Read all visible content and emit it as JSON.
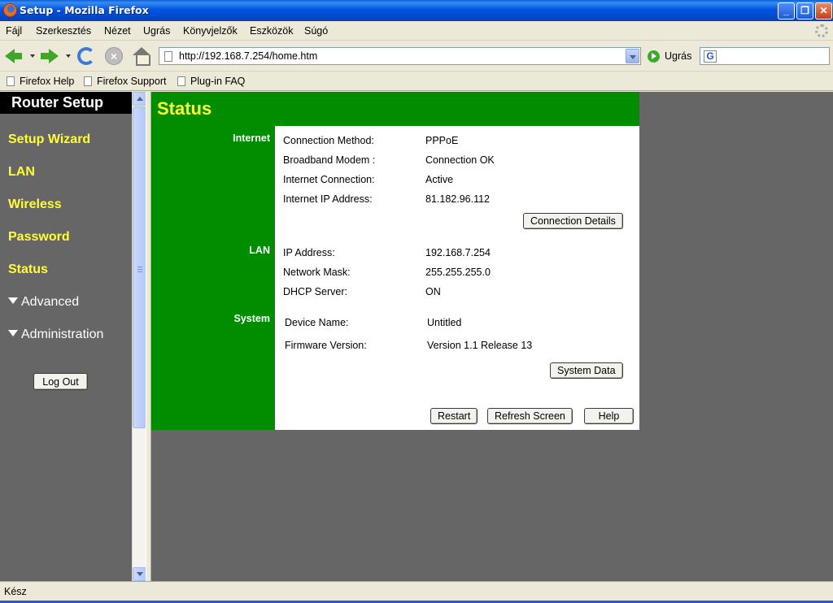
{
  "window": {
    "title": "Setup - Mozilla Firefox"
  },
  "menu": [
    "Fájl",
    "Szerkesztés",
    "Nézet",
    "Ugrás",
    "Könyvjelzők",
    "Eszközök",
    "Súgó"
  ],
  "nav": {
    "url": "http://192.168.7.254/home.htm",
    "go_label": "Ugrás"
  },
  "bookmarks": [
    "Firefox Help",
    "Firefox Support",
    "Plug-in FAQ"
  ],
  "sidebar": {
    "brand": "Router Setup",
    "links": [
      "Setup Wizard",
      "LAN",
      "Wireless",
      "Password",
      "Status"
    ],
    "expandables": [
      "Advanced",
      "Administration"
    ],
    "logout_label": "Log Out"
  },
  "main": {
    "title": "Status",
    "internet": {
      "heading": "Internet",
      "rows": [
        {
          "label": "Connection Method:",
          "value": "PPPoE"
        },
        {
          "label": "Broadband Modem :",
          "value": "Connection OK"
        },
        {
          "label": "Internet Connection:",
          "value": "Active"
        },
        {
          "label": "Internet IP Address:",
          "value": "81.182.96.112"
        }
      ],
      "details_button": "Connection Details"
    },
    "lan": {
      "heading": "LAN",
      "rows": [
        {
          "label": "IP Address:",
          "value": "192.168.7.254"
        },
        {
          "label": "Network Mask:",
          "value": "255.255.255.0"
        },
        {
          "label": "DHCP Server:",
          "value": "ON"
        }
      ]
    },
    "system": {
      "heading": "System",
      "rows": [
        {
          "label": "Device Name:",
          "value": "Untitled"
        },
        {
          "label": "Firmware Version:",
          "value": "Version 1.1 Release 13"
        }
      ],
      "data_button": "System Data"
    },
    "buttons": {
      "restart": "Restart",
      "refresh": "Refresh Screen",
      "help": "Help"
    }
  },
  "status": {
    "text": "Kész"
  },
  "colors": {
    "panel_green": "#008e00",
    "link_yellow": "#ffff33",
    "sidebar_gray": "#666666"
  }
}
